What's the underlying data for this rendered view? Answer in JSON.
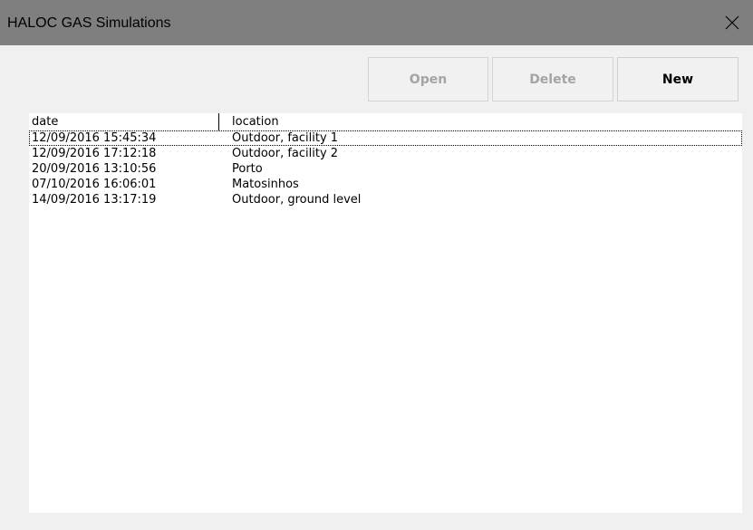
{
  "window": {
    "title": "HALOC GAS Simulations"
  },
  "toolbar": {
    "open_label": "Open",
    "delete_label": "Delete",
    "new_label": "New",
    "open_enabled": false,
    "delete_enabled": false,
    "new_enabled": true
  },
  "list": {
    "columns": [
      "date",
      "location"
    ],
    "selected_index": 0,
    "rows": [
      {
        "date": "12/09/2016 15:45:34",
        "location": "Outdoor, facility 1"
      },
      {
        "date": "12/09/2016 17:12:18",
        "location": "Outdoor, facility 2"
      },
      {
        "date": "20/09/2016 13:10:56",
        "location": "Porto"
      },
      {
        "date": "07/10/2016 16:06:01",
        "location": "Matosinhos"
      },
      {
        "date": "14/09/2016 13:17:19",
        "location": "Outdoor, ground level"
      }
    ]
  },
  "colors": {
    "titlebar": "#7f7f7f",
    "window_bg": "#f0f0f0",
    "list_bg": "#ffffff",
    "disabled_text": "#a4a4a4"
  },
  "icons": {
    "close": "close-icon"
  }
}
